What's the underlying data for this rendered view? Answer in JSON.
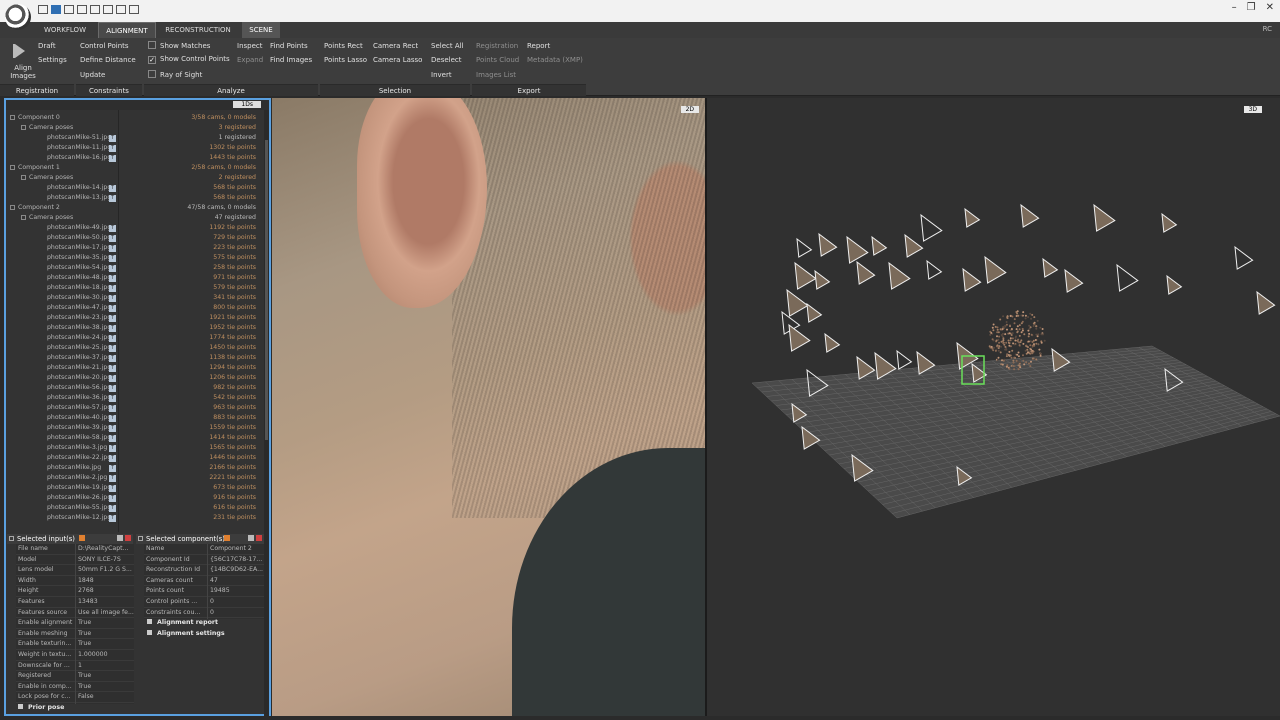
{
  "ribbon": {
    "tabs": [
      "WORKFLOW",
      "ALIGNMENT",
      "RECONSTRUCTION",
      "SCENE"
    ],
    "right_text": "RC",
    "align_images": "Align Images",
    "draft": "Draft",
    "settings": "Settings",
    "control_points": "Control Points",
    "define_distance": "Define Distance",
    "update": "Update",
    "show_matches": "Show Matches",
    "show_control_points": "Show Control Points",
    "ray_of_sight": "Ray of Sight",
    "inspect": "Inspect",
    "expand": "Expand",
    "find_points": "Find Points",
    "find_images": "Find Images",
    "points_rect": "Points Rect",
    "points_lasso": "Points Lasso",
    "camera_rect": "Camera Rect",
    "camera_lasso": "Camera Lasso",
    "select_all": "Select All",
    "deselect": "Deselect",
    "invert": "Invert",
    "registration": "Registration",
    "points_cloud": "Points Cloud",
    "images_list": "Images List",
    "report": "Report",
    "metadata": "Metadata (XMP)",
    "groups": {
      "registration": "Registration",
      "constraints": "Constraints",
      "analyze": "Analyze",
      "selection": "Selection",
      "export": "Export"
    }
  },
  "tree": {
    "header_tag": "1Ds",
    "rows": [
      {
        "name": "Component 0",
        "value": "3/58 cams, 0 models",
        "indent": 0,
        "type": "comp"
      },
      {
        "name": "Camera poses",
        "value": "3 registered",
        "indent": 1,
        "type": "poses"
      },
      {
        "name": "photscanMike-51.jpg",
        "value": "1 registered",
        "indent": 2,
        "type": "img",
        "white": true
      },
      {
        "name": "photscanMike-11.jpg",
        "value": "1302 tie points",
        "indent": 2,
        "type": "img"
      },
      {
        "name": "photscanMike-16.jpg",
        "value": "1443 tie points",
        "indent": 2,
        "type": "img"
      },
      {
        "name": "Component 1",
        "value": "2/58 cams, 0 models",
        "indent": 0,
        "type": "comp"
      },
      {
        "name": "Camera poses",
        "value": "2 registered",
        "indent": 1,
        "type": "poses"
      },
      {
        "name": "photscanMike-14.jpg",
        "value": "568 tie points",
        "indent": 2,
        "type": "img"
      },
      {
        "name": "photscanMike-13.jpg",
        "value": "568 tie points",
        "indent": 2,
        "type": "img"
      },
      {
        "name": "Component 2",
        "value": "47/58 cams, 0 models",
        "indent": 0,
        "type": "comp",
        "white": true
      },
      {
        "name": "Camera poses",
        "value": "47 registered",
        "indent": 1,
        "type": "poses",
        "white": true
      },
      {
        "name": "photscanMike-49.jpg",
        "value": "1192 tie points",
        "indent": 2,
        "type": "img"
      },
      {
        "name": "photscanMike-50.jpg",
        "value": "729 tie points",
        "indent": 2,
        "type": "img"
      },
      {
        "name": "photscanMike-17.jpg",
        "value": "223 tie points",
        "indent": 2,
        "type": "img"
      },
      {
        "name": "photscanMike-35.jpg",
        "value": "575 tie points",
        "indent": 2,
        "type": "img"
      },
      {
        "name": "photscanMike-54.jpg",
        "value": "258 tie points",
        "indent": 2,
        "type": "img"
      },
      {
        "name": "photscanMike-48.jpg",
        "value": "971 tie points",
        "indent": 2,
        "type": "img"
      },
      {
        "name": "photscanMike-18.jpg",
        "value": "579 tie points",
        "indent": 2,
        "type": "img"
      },
      {
        "name": "photscanMike-30.jpg",
        "value": "341 tie points",
        "indent": 2,
        "type": "img"
      },
      {
        "name": "photscanMike-47.jpg",
        "value": "800 tie points",
        "indent": 2,
        "type": "img"
      },
      {
        "name": "photscanMike-23.jpg",
        "value": "1921 tie points",
        "indent": 2,
        "type": "img"
      },
      {
        "name": "photscanMike-38.jpg",
        "value": "1952 tie points",
        "indent": 2,
        "type": "img"
      },
      {
        "name": "photscanMike-24.jpg",
        "value": "1774 tie points",
        "indent": 2,
        "type": "img"
      },
      {
        "name": "photscanMike-25.jpg",
        "value": "1450 tie points",
        "indent": 2,
        "type": "img"
      },
      {
        "name": "photscanMike-37.jpg",
        "value": "1138 tie points",
        "indent": 2,
        "type": "img"
      },
      {
        "name": "photscanMike-21.jpg",
        "value": "1294 tie points",
        "indent": 2,
        "type": "img"
      },
      {
        "name": "photscanMike-20.jpg",
        "value": "1206 tie points",
        "indent": 2,
        "type": "img"
      },
      {
        "name": "photscanMike-56.jpg",
        "value": "982 tie points",
        "indent": 2,
        "type": "img"
      },
      {
        "name": "photscanMike-36.jpg",
        "value": "542 tie points",
        "indent": 2,
        "type": "img"
      },
      {
        "name": "photscanMike-57.jpg",
        "value": "963 tie points",
        "indent": 2,
        "type": "img"
      },
      {
        "name": "photscanMike-40.jpg",
        "value": "883 tie points",
        "indent": 2,
        "type": "img"
      },
      {
        "name": "photscanMike-39.jpg",
        "value": "1559 tie points",
        "indent": 2,
        "type": "img"
      },
      {
        "name": "photscanMike-58.jpg",
        "value": "1414 tie points",
        "indent": 2,
        "type": "img"
      },
      {
        "name": "photscanMike-3.jpg",
        "value": "1565 tie points",
        "indent": 2,
        "type": "img"
      },
      {
        "name": "photscanMike-22.jpg",
        "value": "1446 tie points",
        "indent": 2,
        "type": "img"
      },
      {
        "name": "photscanMike.jpg",
        "value": "2166 tie points",
        "indent": 2,
        "type": "img"
      },
      {
        "name": "photscanMike-2.jpg",
        "value": "2221 tie points",
        "indent": 2,
        "type": "img"
      },
      {
        "name": "photscanMike-19.jpg",
        "value": "673 tie points",
        "indent": 2,
        "type": "img"
      },
      {
        "name": "photscanMike-26.jpg",
        "value": "916 tie points",
        "indent": 2,
        "type": "img"
      },
      {
        "name": "photscanMike-55.jpg",
        "value": "616 tie points",
        "indent": 2,
        "type": "img"
      },
      {
        "name": "photscanMike-12.jpg",
        "value": "231 tie points",
        "indent": 2,
        "type": "img"
      }
    ]
  },
  "inputs_panel": {
    "title": "Selected input(s)",
    "rows": [
      {
        "k": "File name",
        "v": "D:\\RealityCapt..."
      },
      {
        "k": "Model",
        "v": "SONY ILCE-7S"
      },
      {
        "k": "Lens model",
        "v": "50mm F1.2 G S..."
      },
      {
        "k": "Width",
        "v": "1848"
      },
      {
        "k": "Height",
        "v": "2768"
      },
      {
        "k": "Features",
        "v": "13483"
      },
      {
        "k": "Features source",
        "v": "Use all image fe..."
      },
      {
        "k": "Enable alignment",
        "v": "True"
      },
      {
        "k": "Enable meshing",
        "v": "True"
      },
      {
        "k": "Enable texturin...",
        "v": "True"
      },
      {
        "k": "Weight in textu...",
        "v": "1.000000"
      },
      {
        "k": "Downscale for ...",
        "v": "1"
      },
      {
        "k": "Registered",
        "v": "True"
      },
      {
        "k": "Enable in comp...",
        "v": "True"
      },
      {
        "k": "Lock pose for c...",
        "v": "False"
      }
    ],
    "section": "Prior pose"
  },
  "component_panel": {
    "title": "Selected component(s)",
    "rows": [
      {
        "k": "Name",
        "v": "Component 2"
      },
      {
        "k": "Component Id",
        "v": "{56C17C78-17..."
      },
      {
        "k": "Reconstruction Id",
        "v": "{14BC9D62-EA..."
      },
      {
        "k": "Cameras count",
        "v": "47"
      },
      {
        "k": "Points count",
        "v": "19485"
      },
      {
        "k": "Control points ...",
        "v": "0"
      },
      {
        "k": "Constraints cou...",
        "v": "0"
      }
    ],
    "sections": [
      "Alignment report",
      "Alignment settings"
    ]
  },
  "view2d": {
    "tag": "2D"
  },
  "view3d": {
    "tag": "3D"
  },
  "colors": {
    "accent": "#5aa0e0",
    "tie_points": "#c09060",
    "ribbon": "#3d3d3d"
  }
}
